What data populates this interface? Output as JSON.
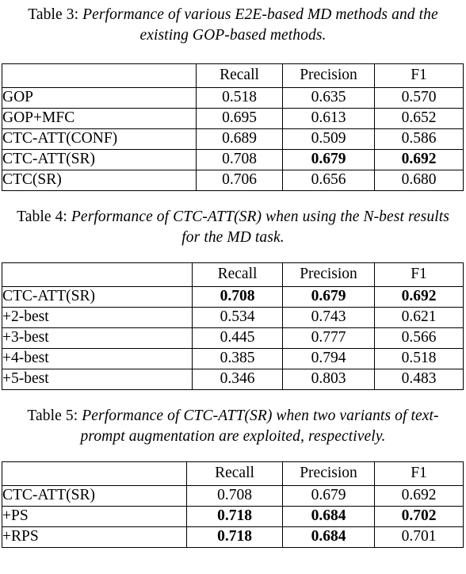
{
  "tables": [
    {
      "caption_label": "Table 3:",
      "caption_text": "Performance of various E2E-based MD methods and the existing GOP-based methods.",
      "columns": [
        "",
        "Recall",
        "Precision",
        "F1"
      ],
      "rows": [
        {
          "name": "GOP",
          "values": [
            "0.518",
            "0.635",
            "0.570"
          ],
          "bold": [
            false,
            false,
            false
          ],
          "group_start": true
        },
        {
          "name": "GOP+MFC",
          "values": [
            "0.695",
            "0.613",
            "0.652"
          ],
          "bold": [
            false,
            false,
            false
          ],
          "group_start": false
        },
        {
          "name": "CTC-ATT(CONF)",
          "values": [
            "0.689",
            "0.509",
            "0.586"
          ],
          "bold": [
            false,
            false,
            false
          ],
          "group_start": true
        },
        {
          "name": "CTC-ATT(SR)",
          "values": [
            "0.708",
            "0.679",
            "0.692"
          ],
          "bold": [
            false,
            true,
            true
          ],
          "group_start": false
        },
        {
          "name": "CTC(SR)",
          "values": [
            "0.706",
            "0.656",
            "0.680"
          ],
          "bold": [
            false,
            false,
            false
          ],
          "group_start": false
        }
      ]
    },
    {
      "caption_label": "Table 4:",
      "caption_text": "Performance of CTC-ATT(SR) when using the N-best results for the MD task.",
      "columns": [
        "",
        "Recall",
        "Precision",
        "F1"
      ],
      "rows": [
        {
          "name": "CTC-ATT(SR)",
          "values": [
            "0.708",
            "0.679",
            "0.692"
          ],
          "bold": [
            true,
            true,
            true
          ],
          "group_start": true
        },
        {
          "name": "+2-best",
          "values": [
            "0.534",
            "0.743",
            "0.621"
          ],
          "bold": [
            false,
            false,
            false
          ],
          "group_start": false
        },
        {
          "name": "+3-best",
          "values": [
            "0.445",
            "0.777",
            "0.566"
          ],
          "bold": [
            false,
            false,
            false
          ],
          "group_start": false
        },
        {
          "name": "+4-best",
          "values": [
            "0.385",
            "0.794",
            "0.518"
          ],
          "bold": [
            false,
            false,
            false
          ],
          "group_start": false
        },
        {
          "name": "+5-best",
          "values": [
            "0.346",
            "0.803",
            "0.483"
          ],
          "bold": [
            false,
            false,
            false
          ],
          "group_start": false
        }
      ]
    },
    {
      "caption_label": "Table 5:",
      "caption_text": "Performance of CTC-ATT(SR) when two variants of text-prompt augmentation are exploited, respectively.",
      "columns": [
        "",
        "Recall",
        "Precision",
        "F1"
      ],
      "rows": [
        {
          "name": "CTC-ATT(SR)",
          "values": [
            "0.708",
            "0.679",
            "0.692"
          ],
          "bold": [
            false,
            false,
            false
          ],
          "group_start": true
        },
        {
          "name": "+PS",
          "values": [
            "0.718",
            "0.684",
            "0.702"
          ],
          "bold": [
            true,
            true,
            true
          ],
          "group_start": false
        },
        {
          "name": "+RPS",
          "values": [
            "0.718",
            "0.684",
            "0.701"
          ],
          "bold": [
            true,
            true,
            false
          ],
          "group_start": false
        }
      ]
    }
  ]
}
